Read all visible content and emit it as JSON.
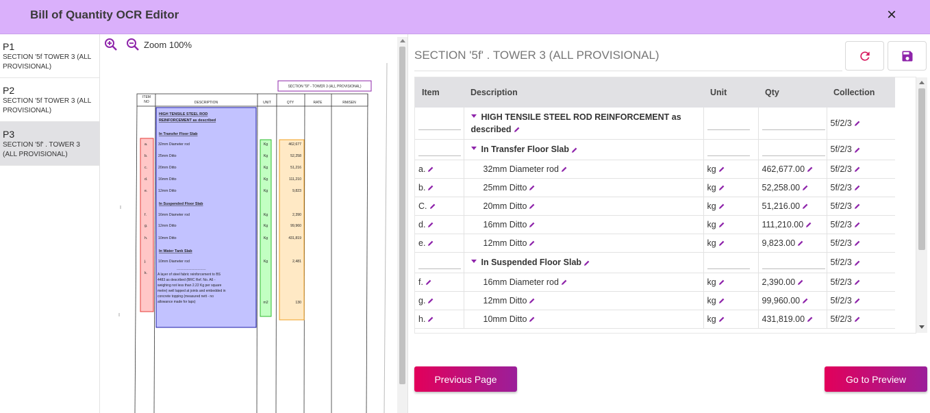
{
  "header": {
    "title": "Bill of Quantity OCR Editor",
    "close_icon": "×"
  },
  "pages": [
    {
      "num": "P1",
      "desc": "SECTION '5f TOWER 3 (ALL PROVISIONAL)"
    },
    {
      "num": "P2",
      "desc": "SECTION '5f TOWER 3 (ALL PROVISIONAL)"
    },
    {
      "num": "P3",
      "desc": "SECTION '5f' . TOWER 3 (ALL PROVISIONAL)"
    }
  ],
  "viewer": {
    "zoom_label": "Zoom 100%"
  },
  "scan": {
    "section_label": "SECTION \"5f\" - TOWER 3 (ALL PROVISIONAL)",
    "headers": {
      "item": "ITEM NO",
      "item_a": "ITEM",
      "item_b": "NO",
      "desc": "DESCRIPTION",
      "unit": "UNIT",
      "qty": "QTY",
      "rate": "RATE",
      "amount": "RM/SEN"
    },
    "h1a": "HIGH TENSILE STEEL ROD",
    "h1b": "REINFORCEMENT as described",
    "h2": "In Transfer Floor Slab",
    "h3": "In Suspended Floor Slab",
    "h4": "In Water Tank Slab",
    "rows": [
      {
        "item": "a.",
        "desc": "32mm Diameter rod",
        "unit": "Kg",
        "qty": "462,677"
      },
      {
        "item": "b.",
        "desc": "25mm Ditto",
        "unit": "Kg",
        "qty": "52,258"
      },
      {
        "item": "c.",
        "desc": "20mm Ditto",
        "unit": "Kg",
        "qty": "51,216"
      },
      {
        "item": "d.",
        "desc": "16mm Ditto",
        "unit": "Kg",
        "qty": "111,210"
      },
      {
        "item": "e.",
        "desc": "12mm Ditto",
        "unit": "Kg",
        "qty": "9,823"
      },
      {
        "item": "f.",
        "desc": "16mm Diameter rod",
        "unit": "Kg",
        "qty": "2,390"
      },
      {
        "item": "g.",
        "desc": "12mm Ditto",
        "unit": "Kg",
        "qty": "99,960"
      },
      {
        "item": "h.",
        "desc": "10mm Ditto",
        "unit": "Kg",
        "qty": "431,819"
      },
      {
        "item": "j.",
        "desc": "10mm Diameter rod",
        "unit": "Kg",
        "qty": "2,481"
      },
      {
        "item": "k.",
        "desc": "",
        "unit": "m2",
        "qty": "130"
      }
    ],
    "k_dash": "--------------------------------",
    "k_lines": [
      "A layer of steel fabric reinforcement to BS",
      "4483 as described (BRC Ref. No. A6 -",
      "weighing not less than 2.22 Kg per square",
      "metre) well lapped at joints and embedded in",
      "concrete topping (measured nett - no",
      "allowance made for laps)"
    ]
  },
  "editor": {
    "title_value": "SECTION '5f' . TOWER 3 (ALL PROVISIONAL)",
    "refresh_icon": "refresh-icon",
    "save_icon": "save-icon",
    "columns": {
      "item": "Item",
      "description": "Description",
      "unit": "Unit",
      "qty": "Qty",
      "collection": "Collection"
    },
    "rows": [
      {
        "type": "section",
        "description": "HIGH TENSILE STEEL ROD REINFORCEMENT as described",
        "collection": "5f/2/3"
      },
      {
        "type": "section",
        "description": "In Transfer Floor Slab",
        "collection": "5f/2/3"
      },
      {
        "type": "item",
        "item": "a.",
        "description": "32mm Diameter rod",
        "unit": "kg",
        "qty": "462,677.00",
        "collection": "5f/2/3"
      },
      {
        "type": "item",
        "item": "b.",
        "description": "25mm Ditto",
        "unit": "kg",
        "qty": "52,258.00",
        "collection": "5f/2/3"
      },
      {
        "type": "item",
        "item": "C.",
        "description": "20mm Ditto",
        "unit": "kg",
        "qty": "51,216.00",
        "collection": "5f/2/3"
      },
      {
        "type": "item",
        "item": "d.",
        "description": "16mm Ditto",
        "unit": "kg",
        "qty": "111,210.00",
        "collection": "5f/2/3"
      },
      {
        "type": "item",
        "item": "e.",
        "description": "12mm Ditto",
        "unit": "kg",
        "qty": "9,823.00",
        "collection": "5f/2/3"
      },
      {
        "type": "section",
        "description": "In Suspended Floor Slab",
        "collection": "5f/2/3"
      },
      {
        "type": "item",
        "item": "f.",
        "description": "16mm Diameter rod",
        "unit": "kg",
        "qty": "2,390.00",
        "collection": "5f/2/3"
      },
      {
        "type": "item",
        "item": "g.",
        "description": "12mm Ditto",
        "unit": "kg",
        "qty": "99,960.00",
        "collection": "5f/2/3"
      },
      {
        "type": "item",
        "item": "h.",
        "description": "10mm Ditto",
        "unit": "kg",
        "qty": "431,819.00",
        "collection": "5f/2/3"
      }
    ]
  },
  "footer": {
    "prev_label": "Previous Page",
    "next_label": "Go to Preview"
  },
  "colors": {
    "header_bg": "#dab0fb",
    "button_gradient_start": "#e2005a",
    "button_gradient_end": "#9b1f9a",
    "edit_icon": "#8e24aa",
    "refresh": "#d81b60",
    "save": "#8e24aa"
  }
}
